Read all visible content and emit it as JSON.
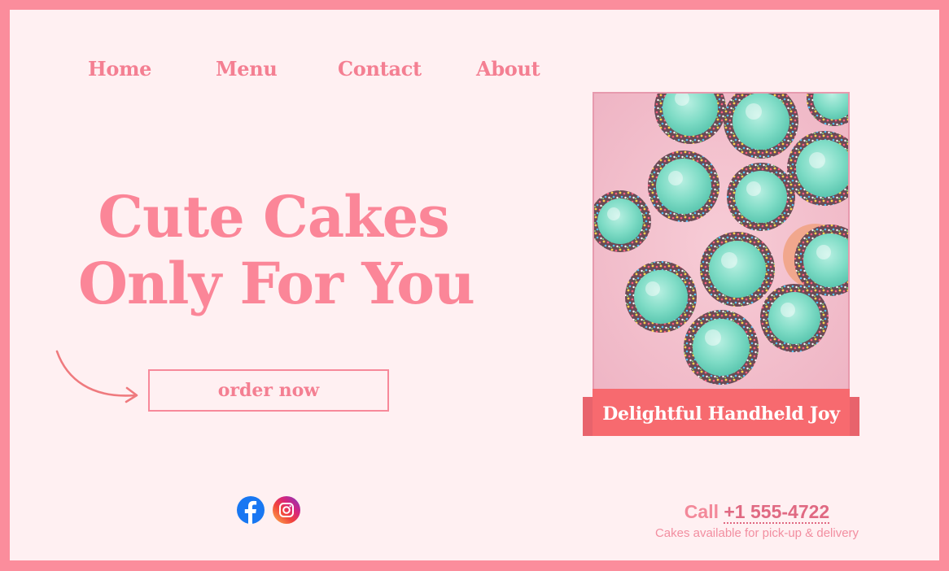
{
  "nav": {
    "items": [
      {
        "label": "Home"
      },
      {
        "label": "Menu"
      },
      {
        "label": "Contact"
      },
      {
        "label": "About"
      }
    ]
  },
  "hero": {
    "title_line_1": "Cute Cakes",
    "title_line_2": "Only For You",
    "order_button_label": "order now"
  },
  "feature": {
    "caption": "Delightful Handheld Joy"
  },
  "footer": {
    "social_icons": [
      "facebook-icon",
      "instagram-icon"
    ],
    "call_label": "Call",
    "phone": "+1 555-4722",
    "availability": "Cakes available for pick-up & delivery"
  },
  "colors": {
    "frame": "#fb8d9c",
    "background": "#fff0f2",
    "accent_text": "#f47f92",
    "caption_band": "#f76a6f"
  }
}
